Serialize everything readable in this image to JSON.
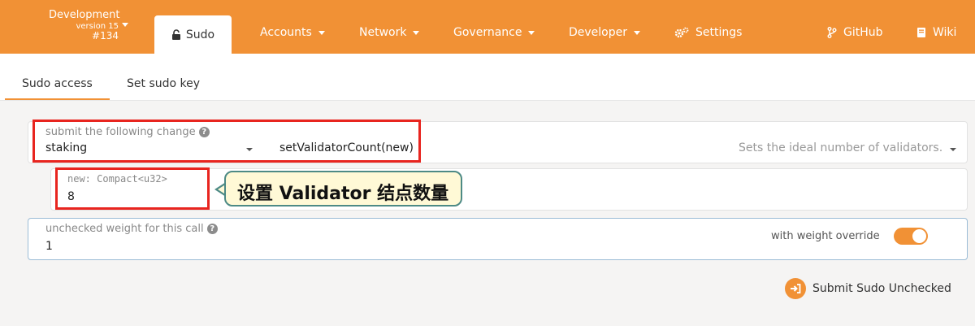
{
  "chain": {
    "name": "Development",
    "version": "version 15",
    "block": "#134"
  },
  "nav": {
    "active_tab": "Sudo",
    "items": [
      "Accounts",
      "Network",
      "Governance",
      "Developer"
    ],
    "settings": "Settings",
    "github": "GitHub",
    "wiki": "Wiki"
  },
  "subtabs": [
    "Sudo access",
    "Set sudo key"
  ],
  "call": {
    "label": "submit the following change",
    "module": "staking",
    "method": "setValidatorCount(new)",
    "description": "Sets the ideal number of validators."
  },
  "param": {
    "label": "new: Compact<u32>",
    "value": "8"
  },
  "annotation": "设置 Validator 结点数量",
  "weight": {
    "label": "unchecked weight for this call",
    "value": "1",
    "override_label": "with weight override",
    "override_on": true
  },
  "submit_label": "Submit Sudo Unchecked",
  "colors": {
    "accent": "#f19135",
    "highlight": "#e8251f",
    "callout_bg": "#fff9d6",
    "callout_border": "#4d8a85"
  }
}
